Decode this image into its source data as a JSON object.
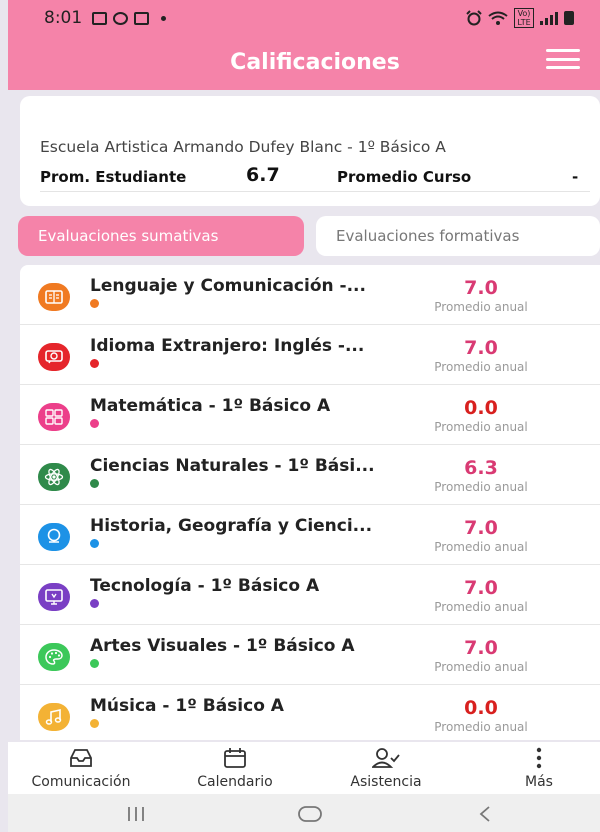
{
  "status_bar": {
    "time": "8:01",
    "network": "Vo) LTE"
  },
  "header": {
    "title": "Calificaciones"
  },
  "school": {
    "name": "Escuela Artistica Armando Dufey Blanc - 1º Básico A",
    "student_avg_label": "Prom. Estudiante",
    "student_avg": "6.7",
    "course_avg_label": "Promedio Curso",
    "course_avg": "-"
  },
  "tabs": [
    {
      "label": "Evaluaciones sumativas",
      "active": true
    },
    {
      "label": "Evaluaciones formativas",
      "active": false
    }
  ],
  "subjects": [
    {
      "name": "Lenguaje y Comunicación -...",
      "grade": "7.0",
      "grade_label": "Promedio anual",
      "color": "#f07a22",
      "grade_color": "#d93a73",
      "icon": "language-icon"
    },
    {
      "name": "Idioma Extranjero: Inglés -...",
      "grade": "7.0",
      "grade_label": "Promedio anual",
      "color": "#e5252b",
      "grade_color": "#d93a73",
      "icon": "foreign-language-icon"
    },
    {
      "name": "Matemática - 1º Básico A",
      "grade": "0.0",
      "grade_label": "Promedio anual",
      "color": "#ec3f8a",
      "grade_color": "#d8201f",
      "icon": "calculator-icon"
    },
    {
      "name": "Ciencias Naturales - 1º Bási...",
      "grade": "6.3",
      "grade_label": "Promedio anual",
      "color": "#2f8a4a",
      "grade_color": "#d93a73",
      "icon": "atom-icon"
    },
    {
      "name": "Historia, Geografía y Cienci...",
      "grade": "7.0",
      "grade_label": "Promedio anual",
      "color": "#1d92e6",
      "grade_color": "#d93a73",
      "icon": "globe-icon"
    },
    {
      "name": "Tecnología - 1º Básico A",
      "grade": "7.0",
      "grade_label": "Promedio anual",
      "color": "#7a3fc4",
      "grade_color": "#d93a73",
      "icon": "computer-icon"
    },
    {
      "name": "Artes Visuales - 1º Básico A",
      "grade": "7.0",
      "grade_label": "Promedio anual",
      "color": "#3cc85a",
      "grade_color": "#d93a73",
      "icon": "palette-icon"
    },
    {
      "name": "Música - 1º Básico A",
      "grade": "0.0",
      "grade_label": "Promedio anual",
      "color": "#f3b235",
      "grade_color": "#d8201f",
      "icon": "music-note-icon"
    }
  ],
  "bottom_nav": [
    {
      "label": "Comunicación",
      "icon": "inbox-icon"
    },
    {
      "label": "Calendario",
      "icon": "calendar-icon"
    },
    {
      "label": "Asistencia",
      "icon": "user-check-icon"
    },
    {
      "label": "Más",
      "icon": "more-vertical-icon"
    }
  ],
  "system_nav": [
    "recent-apps-icon",
    "home-icon",
    "back-icon"
  ]
}
